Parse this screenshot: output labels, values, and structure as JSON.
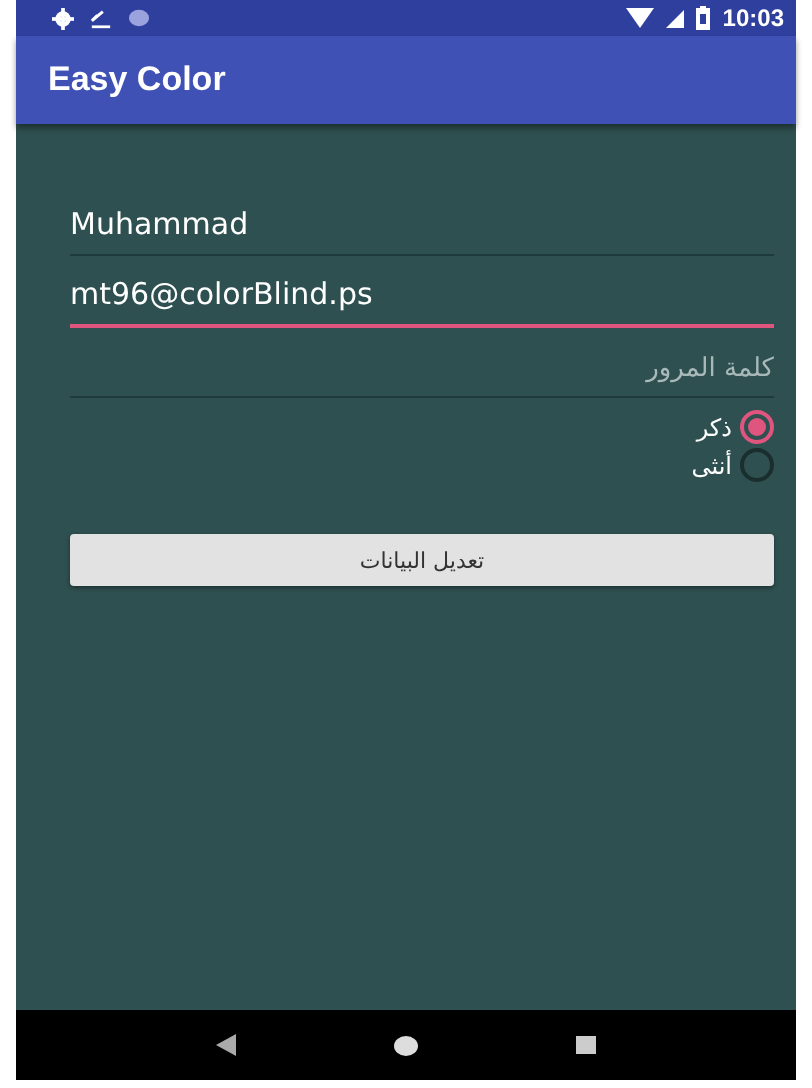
{
  "status_bar": {
    "time": "10:03"
  },
  "app_bar": {
    "title": "Easy Color"
  },
  "form": {
    "fields": [
      {
        "value": "Muhammad",
        "focused": false
      },
      {
        "value": "mt96@colorBlind.ps",
        "focused": true
      },
      {
        "placeholder": "كلمة المرور",
        "focused": false
      }
    ],
    "gender": [
      {
        "label": "ذكر",
        "selected": true
      },
      {
        "label": "أنثى",
        "selected": false
      }
    ],
    "button": "تعديل البيانات"
  }
}
